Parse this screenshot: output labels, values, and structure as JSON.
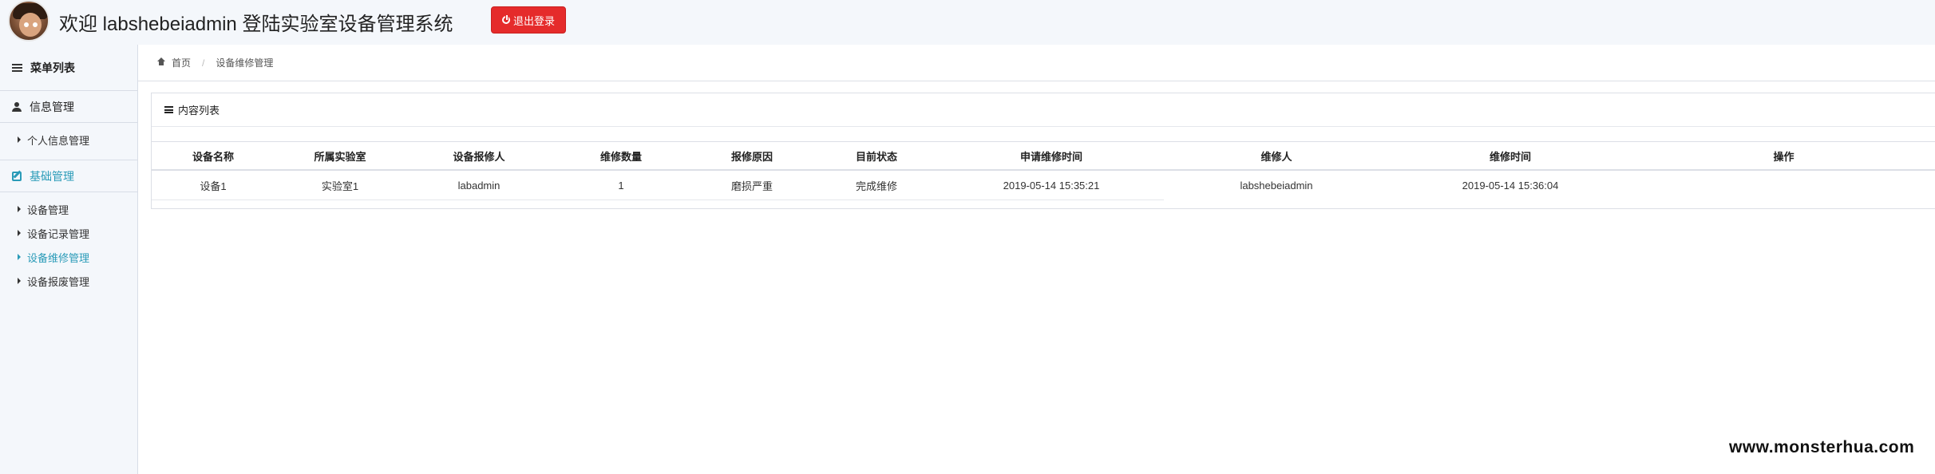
{
  "header": {
    "welcome": "欢迎 labshebeiadmin 登陆实验室设备管理系统",
    "logout_label": "退出登录"
  },
  "sidebar": {
    "title": "菜单列表",
    "groups": [
      {
        "label": "信息管理",
        "items": [
          "个人信息管理"
        ]
      },
      {
        "label": "基础管理",
        "items": [
          "设备管理",
          "设备记录管理",
          "设备维修管理",
          "设备报废管理"
        ]
      }
    ]
  },
  "breadcrumb": {
    "home": "首页",
    "current": "设备维修管理"
  },
  "panel": {
    "title": "内容列表"
  },
  "table": {
    "columns": [
      "设备名称",
      "所属实验室",
      "设备报修人",
      "维修数量",
      "报修原因",
      "目前状态",
      "申请维修时间",
      "维修人",
      "维修时间",
      "操作"
    ],
    "rows": [
      [
        "设备1",
        "实验室1",
        "labadmin",
        "1",
        "磨损严重",
        "完成维修",
        "2019-05-14 15:35:21",
        "labshebeiadmin",
        "2019-05-14 15:36:04",
        ""
      ]
    ]
  },
  "watermark": "www.monsterhua.com",
  "colors": {
    "accent": "#2a9bb8",
    "danger": "#e52b2b",
    "sidebar_bg": "#f4f7fb"
  }
}
